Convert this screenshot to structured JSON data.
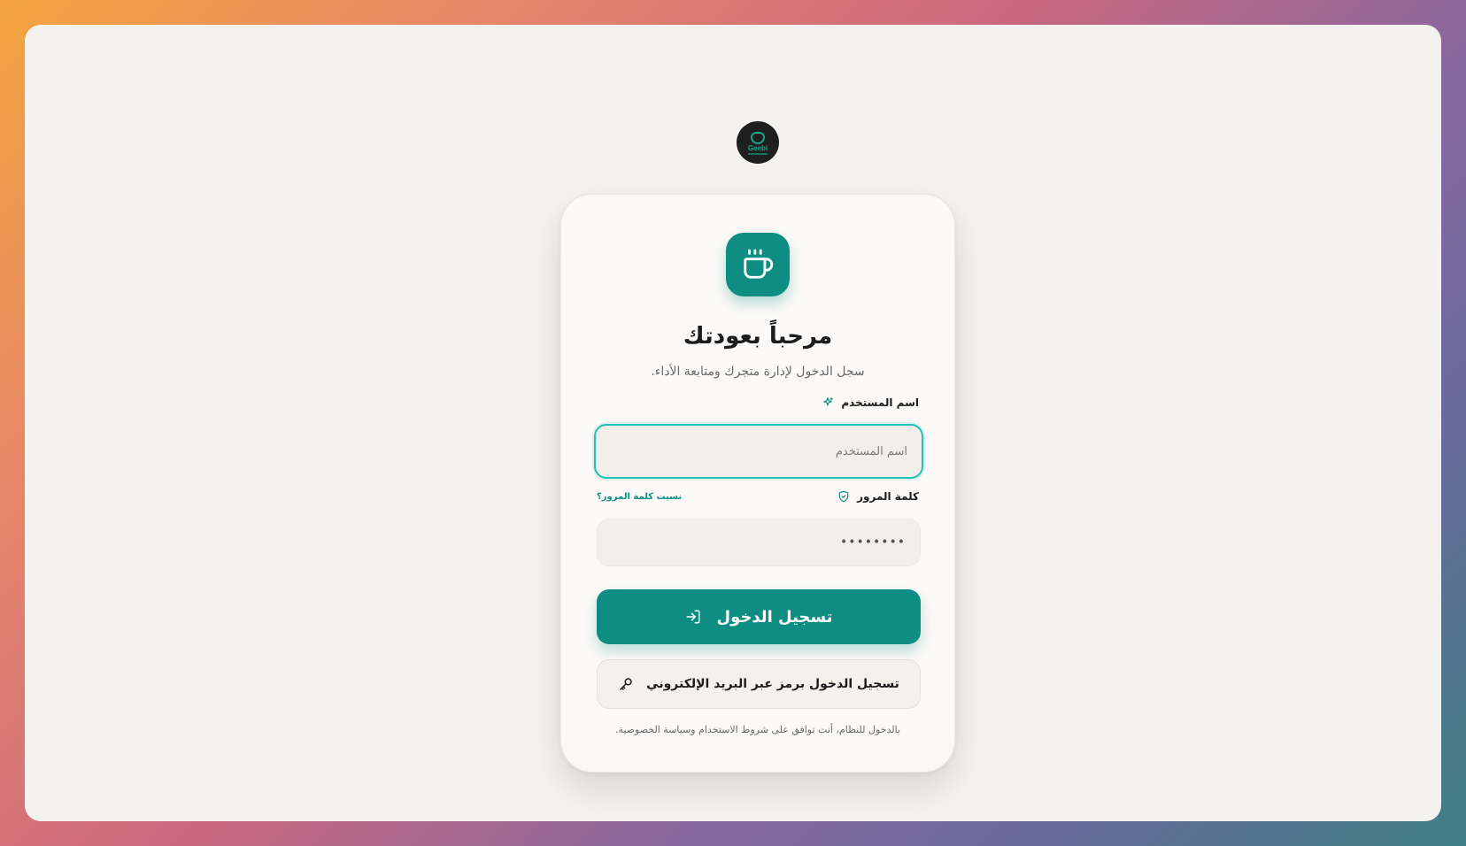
{
  "brand": {
    "logo_text": "Geebi",
    "logo_icon": "geebi-logo-icon"
  },
  "card": {
    "app_icon": "coffee-cup-icon",
    "title": "مرحباً بعودتك",
    "subtitle": "سجل الدخول لإدارة متجرك ومتابعة الأداء."
  },
  "form": {
    "username": {
      "label": "اسم المستخدم",
      "label_icon": "sparkle-icon",
      "placeholder": "اسم المستخدم",
      "value": ""
    },
    "password": {
      "label": "كلمة المرور",
      "label_icon": "shield-icon",
      "forgot_link": "نسيت كلمة المرور؟",
      "value": "••••••••"
    },
    "login_button": {
      "label": "تسجيل الدخول",
      "icon": "login-arrow-icon"
    },
    "email_code_button": {
      "label": "تسجيل الدخول برمز عبر البريد الإلكتروني",
      "icon": "key-icon"
    },
    "terms_text": "بالدخول للنظام، أنت توافق على شروط الاستخدام وسياسة الخصوصية."
  },
  "colors": {
    "accent": "#0e8e82",
    "focus_ring": "#22c1b5",
    "card_bg": "#faf9f7",
    "frame_bg": "#f4f2ee"
  }
}
